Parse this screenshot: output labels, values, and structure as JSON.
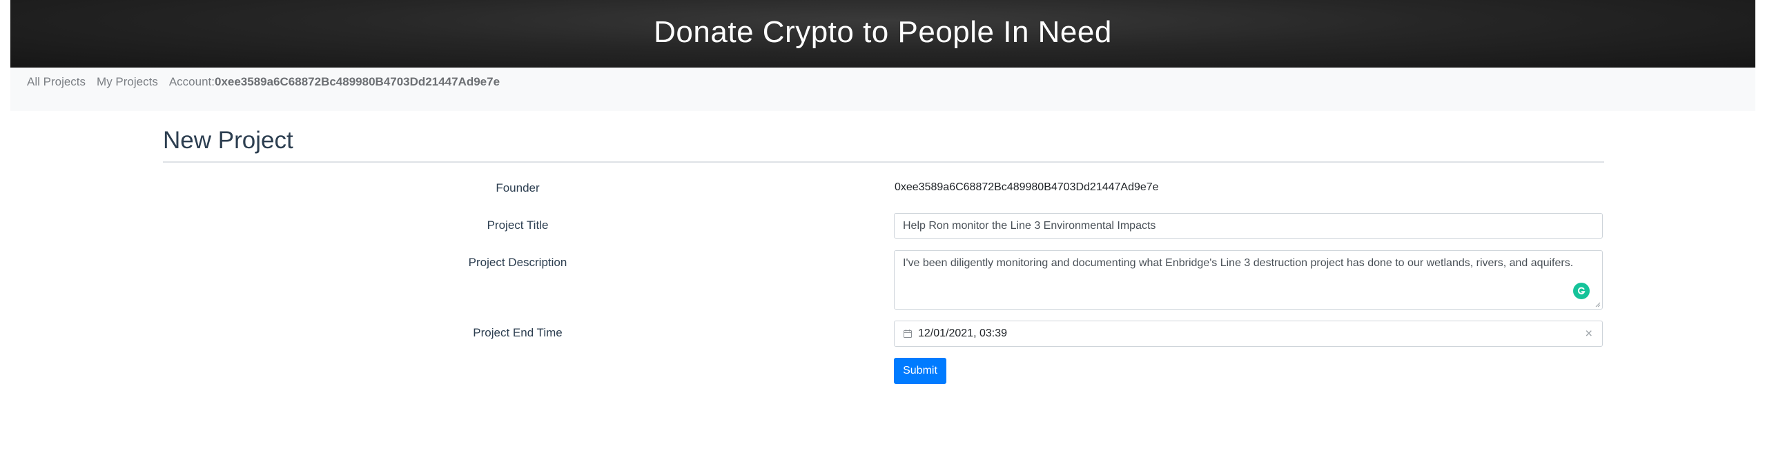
{
  "header": {
    "title": "Donate Crypto to People In Need"
  },
  "nav": {
    "all_projects": "All Projects",
    "my_projects": "My Projects",
    "account_label": "Account:",
    "account_address": "0xee3589a6C68872Bc489980B4703Dd21447Ad9e7e"
  },
  "page": {
    "title": "New Project"
  },
  "form": {
    "founder_label": "Founder",
    "founder_value": "0xee3589a6C68872Bc489980B4703Dd21447Ad9e7e",
    "project_title_label": "Project Title",
    "project_title_value": "Help Ron monitor the Line 3 Environmental Impacts",
    "project_description_label": "Project Description",
    "project_description_value": "I've been diligently monitoring and documenting what Enbridge's Line 3 destruction project has done to our wetlands, rivers, and aquifers.",
    "end_time_label": "Project End Time",
    "end_time_value": "12/01/2021, 03:39",
    "submit_label": "Submit"
  },
  "icons": {
    "calendar": "calendar-icon",
    "clear": "close-icon",
    "grammarly": "grammarly-icon"
  },
  "colors": {
    "primary": "#007bff",
    "grammarly": "#15c39a",
    "header_bg": "#262626",
    "navbar_bg": "#f8f9fa"
  }
}
